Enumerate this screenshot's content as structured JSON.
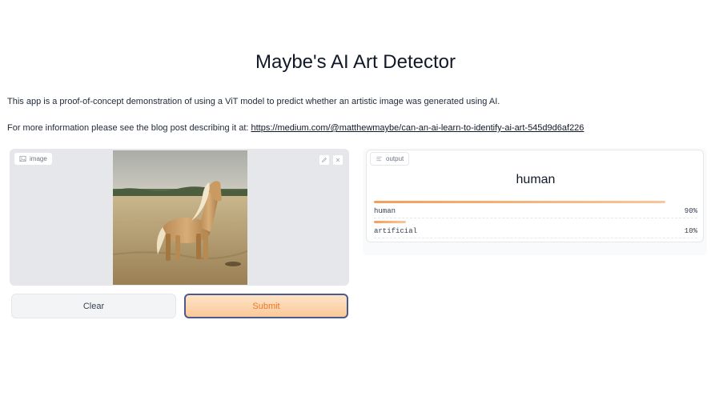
{
  "page": {
    "title": "Maybe's AI Art Detector",
    "description": "This app is a proof-of-concept demonstration of using a ViT model to predict whether an artistic image was generated using AI.",
    "info_prefix": "For more information please see the blog post describing it at:",
    "info_link": "https://medium.com/@matthewmaybe/can-an-ai-learn-to-identify-ai-art-545d9d6af226"
  },
  "input": {
    "label": "image",
    "image_icon": "image-icon",
    "tools": [
      "edit-icon",
      "close-icon"
    ]
  },
  "buttons": {
    "clear": "Clear",
    "submit": "Submit"
  },
  "output": {
    "label": "output",
    "icon": "label-icon",
    "top_label": "human",
    "confidences": [
      {
        "label": "human",
        "value": 0.9,
        "display": "90%"
      },
      {
        "label": "artificial",
        "value": 0.1,
        "display": "10%"
      }
    ]
  },
  "colors": {
    "accent": "#f59e5a",
    "submit_text": "#ea7a2b",
    "submit_border": "#4b5a8c",
    "panel_bg": "#e5e7eb"
  }
}
